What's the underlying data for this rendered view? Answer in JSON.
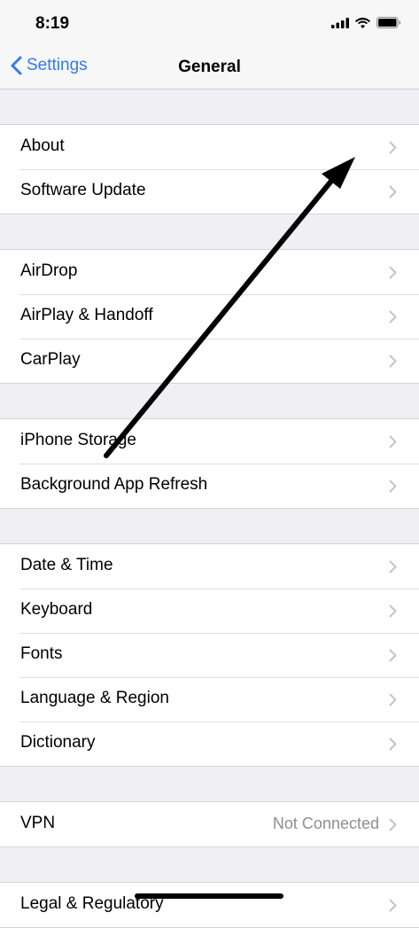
{
  "status_bar": {
    "time": "8:19"
  },
  "nav": {
    "back_label": "Settings",
    "title": "General"
  },
  "groups": [
    {
      "rows": [
        {
          "label": "About"
        },
        {
          "label": "Software Update"
        }
      ]
    },
    {
      "rows": [
        {
          "label": "AirDrop"
        },
        {
          "label": "AirPlay & Handoff"
        },
        {
          "label": "CarPlay"
        }
      ]
    },
    {
      "rows": [
        {
          "label": "iPhone Storage"
        },
        {
          "label": "Background App Refresh"
        }
      ]
    },
    {
      "rows": [
        {
          "label": "Date & Time"
        },
        {
          "label": "Keyboard"
        },
        {
          "label": "Fonts"
        },
        {
          "label": "Language & Region"
        },
        {
          "label": "Dictionary"
        }
      ]
    },
    {
      "rows": [
        {
          "label": "VPN",
          "value": "Not Connected"
        }
      ]
    },
    {
      "rows": [
        {
          "label": "Legal & Regulatory"
        }
      ]
    }
  ],
  "colors": {
    "accent": "#3478f6",
    "background": "#efeff4",
    "secondary_text": "#8e8e93"
  },
  "icons": [
    "signal-icon",
    "wifi-icon",
    "battery-icon",
    "back-chevron-icon",
    "chevron-right-icon",
    "annotation-arrow"
  ]
}
